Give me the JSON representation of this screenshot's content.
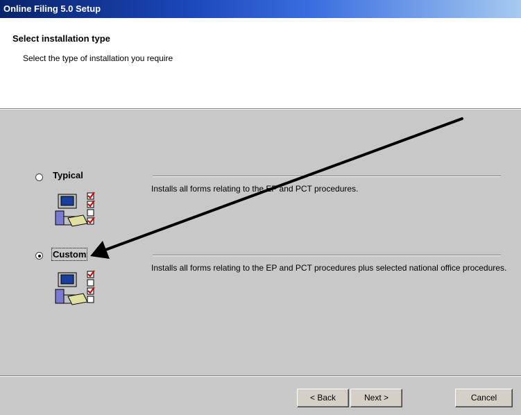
{
  "window": {
    "title": "Online Filing 5.0 Setup"
  },
  "header": {
    "heading": "Select installation type",
    "subtitle": "Select the type of installation you require"
  },
  "options": [
    {
      "label": "Typical",
      "selected": false,
      "description": "Installs all forms relating to the EP and PCT procedures.",
      "icon": "setup-forms-icon"
    },
    {
      "label": "Custom",
      "selected": true,
      "description": "Installs all forms relating to the EP and PCT procedures plus selected national office procedures.",
      "icon": "setup-forms-icon"
    }
  ],
  "buttons": {
    "back": "< Back",
    "next": "Next >",
    "cancel": "Cancel"
  },
  "colors": {
    "title_bar": "#0a246a",
    "panel": "#c8c8c8",
    "annotation_arrow": "#000000"
  },
  "annotation": {
    "type": "arrow",
    "points_to": "Custom"
  }
}
